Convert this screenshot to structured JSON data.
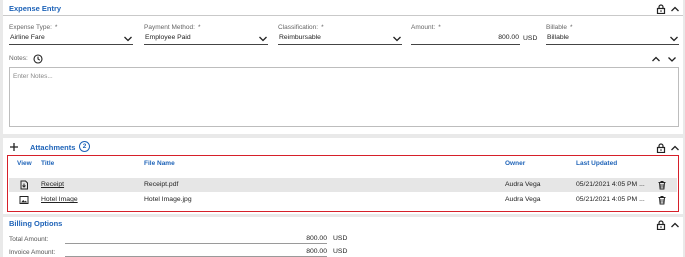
{
  "expense_entry": {
    "title": "Expense Entry",
    "fields": {
      "expense_type": {
        "label": "Expense Type:",
        "value": "Airline Fare"
      },
      "payment_method": {
        "label": "Payment Method:",
        "value": "Employee Paid"
      },
      "classification": {
        "label": "Classification:",
        "value": "Reimbursable"
      },
      "amount": {
        "label": "Amount:",
        "value": "800.00",
        "currency": "USD"
      },
      "billable": {
        "label": "Billable",
        "value": "Billable"
      }
    },
    "required_mark": "*",
    "notes": {
      "label": "Notes:",
      "placeholder": "Enter Notes..."
    }
  },
  "attachments": {
    "title": "Attachments",
    "count": "2",
    "columns": [
      "View",
      "Title",
      "File Name",
      "Owner",
      "Last Updated"
    ],
    "rows": [
      {
        "view_icon": "file-download-icon",
        "title": "Receipt",
        "file_name": "Receipt.pdf",
        "owner": "Audra Vega",
        "last_updated": "05/21/2021 4:05 PM ..."
      },
      {
        "view_icon": "image-icon",
        "title": "Hotel Image",
        "file_name": "Hotel Image.jpg",
        "owner": "Audra Vega",
        "last_updated": "05/21/2021 4:05 PM ..."
      }
    ]
  },
  "billing_options": {
    "title": "Billing Options",
    "rows": [
      {
        "label": "Total Amount:",
        "value": "800.00",
        "currency": "USD"
      },
      {
        "label": "Invoice Amount:",
        "value": "800.00",
        "currency": "USD"
      }
    ]
  },
  "colors": {
    "accent": "#1e63b8",
    "highlight_border": "#d6202a",
    "row_shade": "#e6e6e6"
  }
}
